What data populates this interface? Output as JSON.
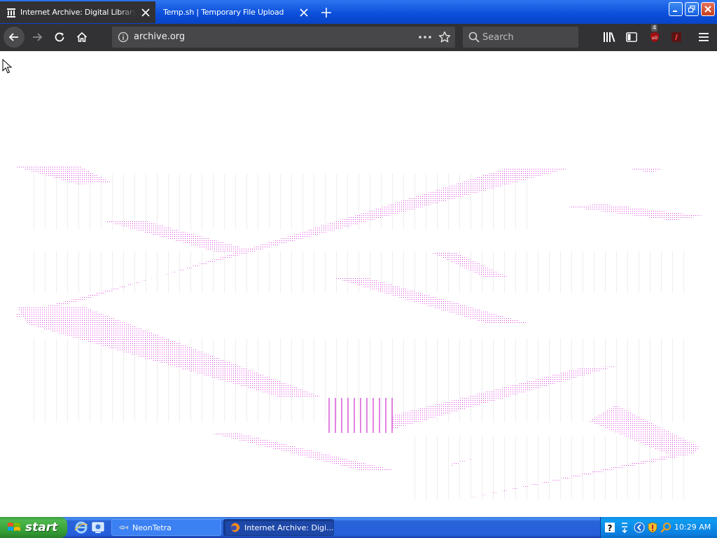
{
  "browser": {
    "tabs": [
      {
        "title": "Internet Archive: Digital Library of",
        "active": true
      },
      {
        "title": "Temp.sh | Temporary File Upload",
        "active": false
      }
    ],
    "url": "archive.org",
    "search_placeholder": "Search",
    "ublock_badge": "4"
  },
  "taskbar": {
    "start_label": "start",
    "buttons": [
      {
        "label": "NeonTetra"
      },
      {
        "label": "Internet Archive: Digi..."
      }
    ],
    "clock": "10:29 AM"
  },
  "colors": {
    "tab_strip": "#0a4ed9",
    "toolbar": "#323234",
    "urlbar": "#474749",
    "graphic_magenta": "#e040e0",
    "taskbar_blue": "#245edc",
    "start_green": "#3c9a3c",
    "tray_blue": "#0f9bf0"
  }
}
